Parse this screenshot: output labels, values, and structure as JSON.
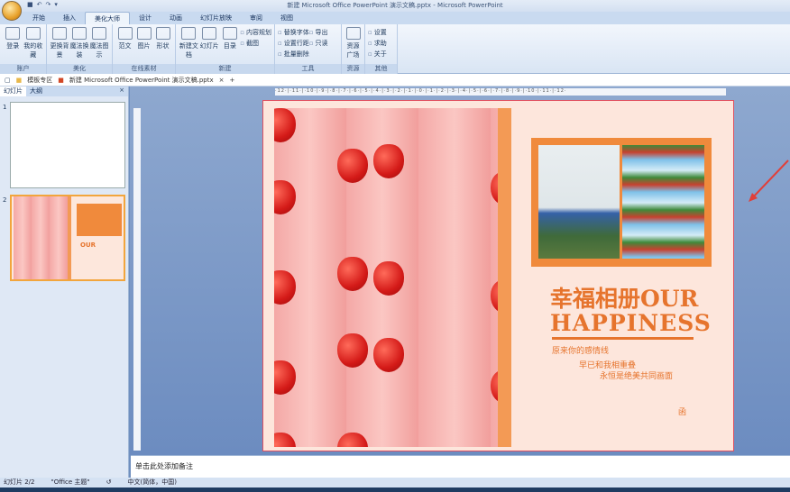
{
  "window": {
    "title": "新建 Microsoft Office PowerPoint 演示文稿.pptx - Microsoft PowerPoint"
  },
  "qat": [
    "save-icon",
    "undo-icon",
    "redo-icon",
    "customize-icon"
  ],
  "tabs": [
    "开始",
    "插入",
    "美化大师",
    "设计",
    "动画",
    "幻灯片放映",
    "审阅",
    "视图"
  ],
  "active_tab": "美化大师",
  "ribbon": {
    "account": {
      "label": "账户",
      "login": "登录",
      "favorites": "我的收藏"
    },
    "beautify": {
      "label": "美化",
      "bg": "更换背景",
      "outfit": "魔法换装",
      "diagram": "魔法图示"
    },
    "online": {
      "label": "在线素材",
      "sample": "范文",
      "picture": "图片",
      "shape": "形状"
    },
    "new": {
      "label": "新建",
      "doc": "新建文档",
      "slide": "幻灯片",
      "toc": "目录",
      "plan": "内容规划",
      "shot": "截图"
    },
    "tools": {
      "label": "工具",
      "font": "替换字体",
      "export": "导出",
      "spacing": "设置行距",
      "readonly": "只读",
      "batch": "批量删除"
    },
    "resource": {
      "label": "资源",
      "square": "资源广场"
    },
    "other": {
      "label": "其他",
      "settings": "设置",
      "help": "求助",
      "about": "关于"
    }
  },
  "doctabs": {
    "template": "模板专区",
    "file": "新建 Microsoft Office PowerPoint 演示文稿.pptx",
    "close": "×",
    "add": "+"
  },
  "pane": {
    "tab_slides": "幻灯片",
    "tab_outline": "大纲",
    "close": "×",
    "slide_nums": [
      "1",
      "2"
    ]
  },
  "ruler": "·12·|·11·|·10·|·9·|·8·|·7·|·6·|·5·|·4·|·3·|·2·|·1·|·0·|·1·|·2·|·3·|·4·|·5·|·6·|·7·|·8·|·9·|·10·|·11·|·12·",
  "slide": {
    "title_cn": "幸福相册",
    "title_en1": "OUR",
    "title_en2": "HAPPINESS",
    "poem": [
      "原来你的感情线",
      "早已和我相重叠",
      "永恒是绝美共同画面"
    ],
    "mark": "函"
  },
  "notes": {
    "placeholder": "单击此处添加备注"
  },
  "status": {
    "slide": "幻灯片 2/2",
    "theme": "\"Office 主题\"",
    "lang": "中文(简体，中国)"
  },
  "colors": {
    "accent": "#e6742d",
    "arrow": "#e0403a"
  }
}
